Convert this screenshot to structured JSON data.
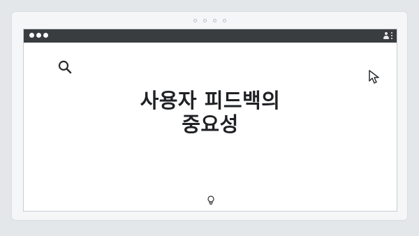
{
  "slide": {
    "headline": "사용자 피드백의\n중요성"
  },
  "icons": {
    "search": "search-icon",
    "cursor": "cursor-icon",
    "lightbulb": "lightbulb-icon",
    "user": "user-icon",
    "menu": "kebab-menu-icon"
  },
  "colors": {
    "titlebar": "#3a3d40",
    "background": "#e4e7ea",
    "text": "#1f2124"
  }
}
